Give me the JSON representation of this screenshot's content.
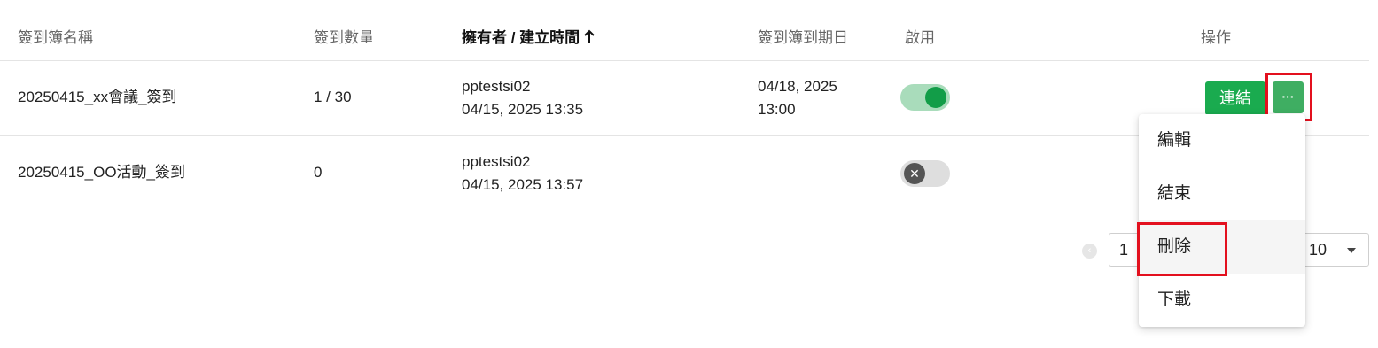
{
  "table": {
    "headers": {
      "name": "簽到簿名稱",
      "count": "簽到數量",
      "owner": "擁有者 / 建立時間",
      "end_date": "簽到簿到期日",
      "enabled": "啟用",
      "actions": "操作"
    },
    "rows": [
      {
        "name": "20250415_xx會議_簽到",
        "count": "1 / 30",
        "owner": "pptestsi02",
        "created": "04/15, 2025 13:35",
        "end_date": "04/18, 2025",
        "end_time": "13:00",
        "enabled": true
      },
      {
        "name": "20250415_OO活動_簽到",
        "count": "0",
        "owner": "pptestsi02",
        "created": "04/15, 2025 13:57",
        "end_date": "",
        "end_time": "",
        "enabled": false
      }
    ]
  },
  "actions": {
    "link_label": "連結",
    "more_label": "···"
  },
  "menu": {
    "items": [
      {
        "label": "編輯"
      },
      {
        "label": "結束"
      },
      {
        "label": "刪除"
      },
      {
        "label": "下載"
      }
    ]
  },
  "pagination": {
    "current_page": "1",
    "page_size": "10"
  },
  "colors": {
    "primary_green": "#1aab4f",
    "toggle_on": "#129d48",
    "highlight_red": "#e3101e"
  }
}
